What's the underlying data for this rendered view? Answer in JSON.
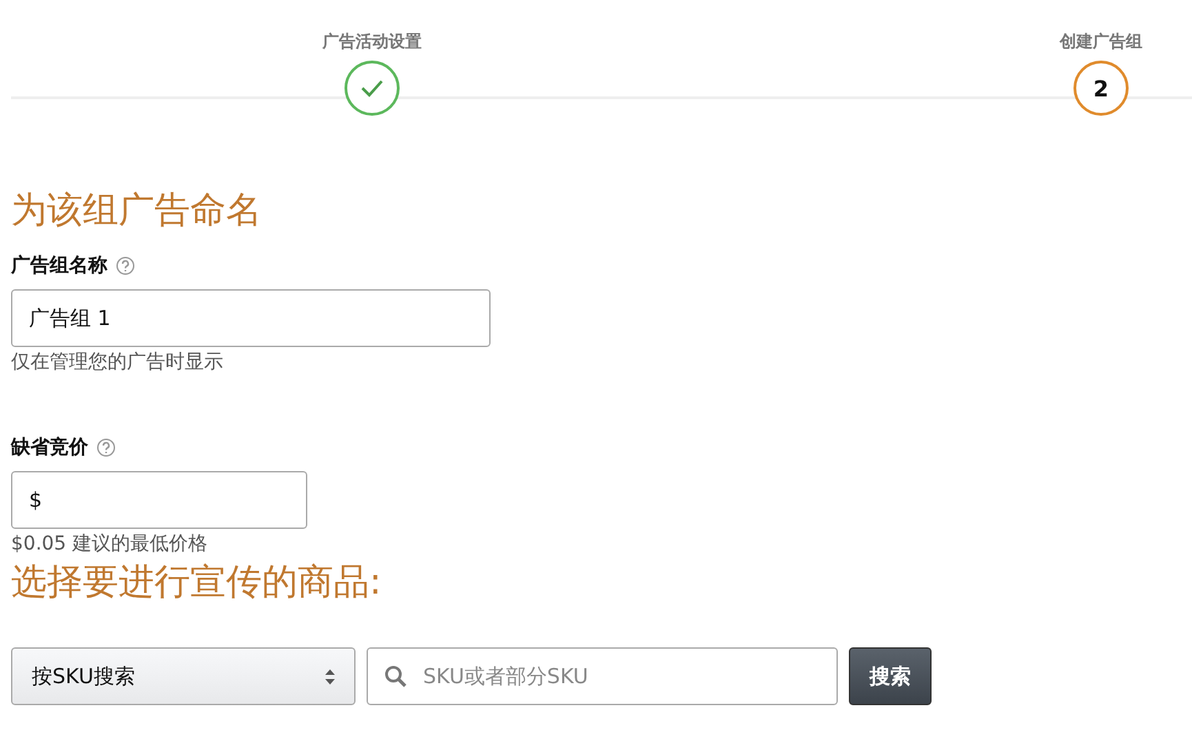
{
  "steps": [
    {
      "label": "广告活动设置",
      "kind": "done"
    },
    {
      "label": "创建广告组",
      "kind": "current",
      "number": "2"
    }
  ],
  "name_section": {
    "heading": "为该组广告命名",
    "label": "广告组名称",
    "value": "广告组 1",
    "hint": "仅在管理您的广告时显示"
  },
  "bid_section": {
    "label": "缺省竞价",
    "value": "$",
    "hint": "$0.05 建议的最低价格"
  },
  "products_section": {
    "heading": "选择要进行宣传的商品:",
    "select_value": "按SKU搜索",
    "search_placeholder": "SKU或者部分SKU",
    "search_button": "搜索"
  }
}
